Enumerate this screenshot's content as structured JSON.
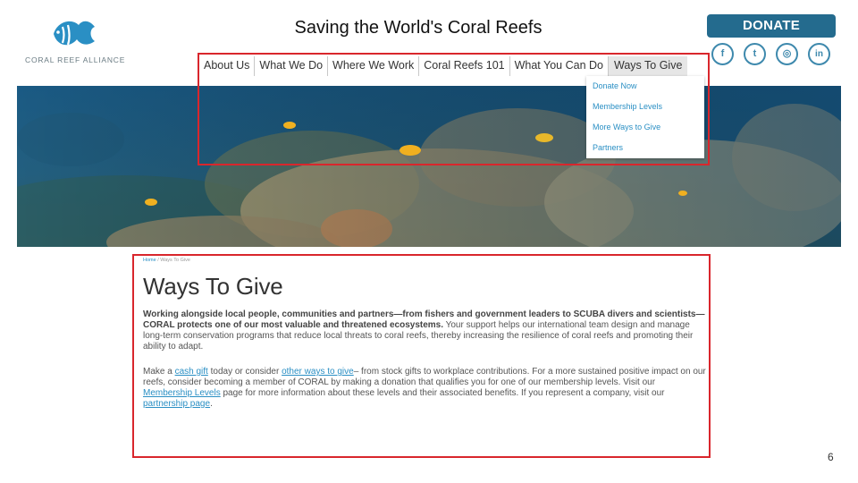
{
  "logo": {
    "text": "CORAL REEF ALLIANCE",
    "icon": "fish-logo-icon",
    "color": "#2a8fc4"
  },
  "slide": {
    "title": "Saving the World's Coral Reefs",
    "page_number": "6"
  },
  "donate": {
    "label": "DONATE",
    "color": "#246b8e"
  },
  "social": [
    {
      "name": "facebook-icon",
      "glyph": "f"
    },
    {
      "name": "twitter-icon",
      "glyph": "t"
    },
    {
      "name": "instagram-icon",
      "glyph": "◎"
    },
    {
      "name": "linkedin-icon",
      "glyph": "in"
    }
  ],
  "nav": {
    "items": [
      "About Us",
      "What We Do",
      "Where We Work",
      "Coral Reefs 101",
      "What You Can Do",
      "Ways To Give"
    ],
    "active": "Ways To Give"
  },
  "dropdown": {
    "items": [
      "Donate Now",
      "Membership Levels",
      "More Ways to Give",
      "Partners"
    ]
  },
  "breadcrumb": {
    "home": "Home",
    "separator": " / ",
    "current": "Ways To Give"
  },
  "main": {
    "heading": "Ways To Give",
    "para1_bold": "Working alongside local people, communities and partners—from fishers and government leaders to SCUBA divers and scientists—CORAL protects one of our most valuable and threatened ecosystems.",
    "para1_rest": " Your support helps our international team design and manage long-term conservation programs that reduce local threats to coral reefs, thereby increasing the resilience of coral reefs and promoting their ability to adapt.",
    "p2_a": "Make a ",
    "p2_link1": "cash gift",
    "p2_b": " today or consider ",
    "p2_link2": "other ways to give",
    "p2_c": "– from stock gifts to workplace contributions. For a more sustained positive impact on our reefs, consider becoming a member of CORAL by making a donation that qualifies you for one of our membership levels. Visit our ",
    "p2_link3": "Membership Levels",
    "p2_d": " page for more information about these levels and their associated benefits. If you represent a company, visit our ",
    "p2_link4": "partnership page",
    "p2_e": "."
  },
  "colors": {
    "link": "#2a8fc4",
    "highlight_box": "#d9262c",
    "ocean": "#1d4f73"
  }
}
